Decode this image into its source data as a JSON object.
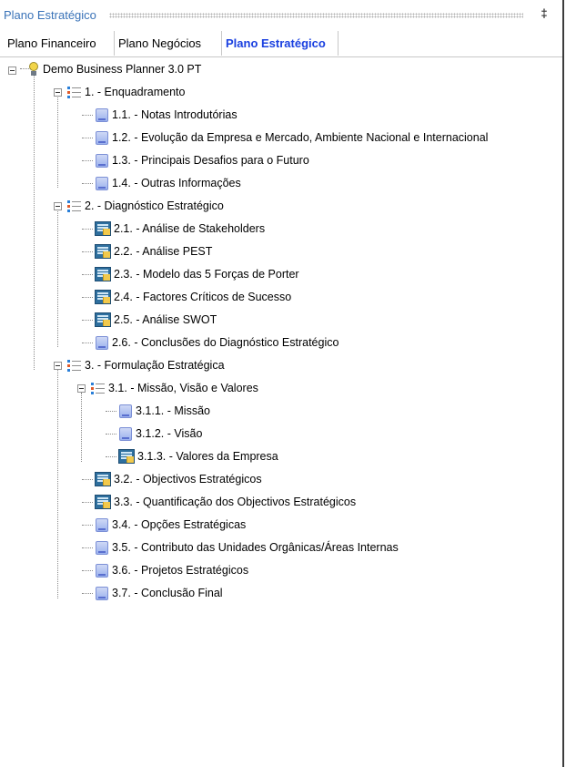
{
  "panel": {
    "title": "Plano Estratégico",
    "pin_glyph": "‡"
  },
  "tabs": [
    {
      "label": "Plano Financeiro",
      "active": false
    },
    {
      "label": "Plano Negócios",
      "active": false
    },
    {
      "label": "Plano Estratégico",
      "active": true
    }
  ],
  "tree": {
    "root": "Demo Business Planner 3.0 PT",
    "items": [
      {
        "label": "1. - Enquadramento",
        "icon": "list-icon"
      },
      {
        "label": "1.1. - Notas Introdutórias",
        "icon": "document-icon"
      },
      {
        "label": "1.2. - Evolução da Empresa e Mercado, Ambiente Nacional e Internacional",
        "icon": "document-icon"
      },
      {
        "label": "1.3. - Principais Desafios para o Futuro",
        "icon": "document-icon"
      },
      {
        "label": "1.4. - Outras Informações",
        "icon": "document-icon"
      },
      {
        "label": "2. - Diagnóstico Estratégico",
        "icon": "list-icon"
      },
      {
        "label": "2.1. - Análise de Stakeholders",
        "icon": "analysis-icon"
      },
      {
        "label": "2.2. - Análise PEST",
        "icon": "analysis-icon"
      },
      {
        "label": "2.3. - Modelo das 5 Forças de Porter",
        "icon": "analysis-icon"
      },
      {
        "label": "2.4. - Factores Críticos de Sucesso",
        "icon": "analysis-icon"
      },
      {
        "label": "2.5. - Análise SWOT",
        "icon": "analysis-icon"
      },
      {
        "label": "2.6. - Conclusões do Diagnóstico Estratégico",
        "icon": "document-icon"
      },
      {
        "label": "3. - Formulação Estratégica",
        "icon": "list-icon"
      },
      {
        "label": "3.1. - Missão, Visão e Valores",
        "icon": "list-icon"
      },
      {
        "label": "3.1.1. - Missão",
        "icon": "document-icon"
      },
      {
        "label": "3.1.2. - Visão",
        "icon": "document-icon"
      },
      {
        "label": "3.1.3. - Valores da Empresa",
        "icon": "analysis-icon"
      },
      {
        "label": "3.2. - Objectivos Estratégicos",
        "icon": "analysis-icon"
      },
      {
        "label": "3.3. - Quantificação dos Objectivos Estratégicos",
        "icon": "analysis-icon"
      },
      {
        "label": "3.4. - Opções Estratégicas",
        "icon": "document-icon"
      },
      {
        "label": "3.5. - Contributo das Unidades Orgânicas/Áreas Internas",
        "icon": "document-icon"
      },
      {
        "label": "3.6. - Projetos Estratégicos",
        "icon": "document-icon"
      },
      {
        "label": "3.7. - Conclusão Final",
        "icon": "document-icon"
      }
    ]
  },
  "colors": {
    "title": "#3a73b8",
    "active_tab": "#1a40e0",
    "tree_lines": "#8a8a8a"
  }
}
